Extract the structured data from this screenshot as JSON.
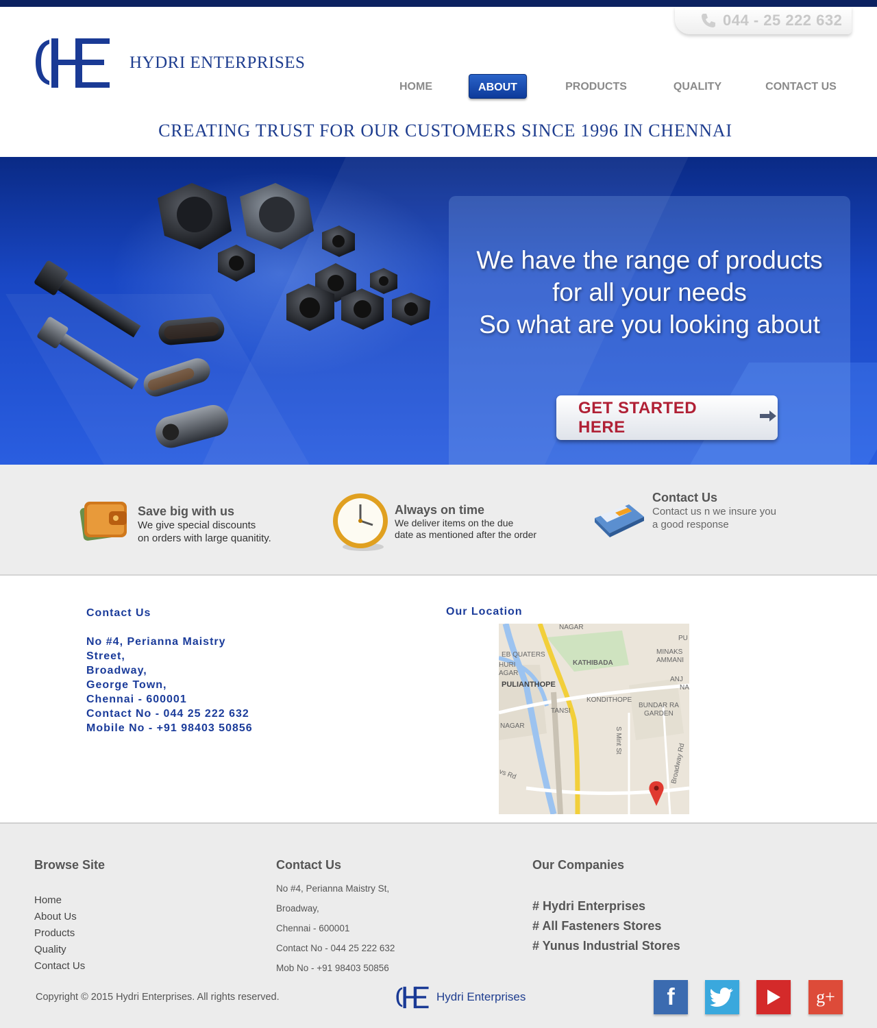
{
  "header": {
    "phone": "044 - 25 222 632",
    "company_name": "HYDRI ENTERPRISES",
    "tagline": "CREATING TRUST FOR OUR CUSTOMERS SINCE 1996 IN CHENNAI"
  },
  "nav": {
    "items": [
      {
        "label": "HOME",
        "active": false
      },
      {
        "label": "ABOUT",
        "active": true
      },
      {
        "label": "PRODUCTS",
        "active": false
      },
      {
        "label": "QUALITY",
        "active": false
      },
      {
        "label": "CONTACT US",
        "active": false
      }
    ]
  },
  "hero": {
    "line1": "We have the range of products",
    "line2": "for all your needs",
    "line3": "So what are you looking about",
    "button_label": "GET STARTED HERE"
  },
  "features": [
    {
      "icon": "wallet-icon",
      "title": "Save big with us",
      "desc1": "We give special discounts",
      "desc2": "on orders with large quanitity."
    },
    {
      "icon": "clock-icon",
      "title": "Always on time",
      "desc1": "We deliver items on the due",
      "desc2": "date as mentioned after the order"
    },
    {
      "icon": "calculator-phone-icon",
      "title": "Contact Us",
      "desc1": "Contact us n we insure you",
      "desc2": "a good response"
    }
  ],
  "contact": {
    "title": "Contact Us",
    "lines": [
      "No #4, Perianna Maistry",
      "Street,",
      "Broadway,",
      "George Town,",
      "Chennai - 600001",
      "Contact No - 044 25 222 632",
      "Mobile No - +91 98403 50856"
    ]
  },
  "location": {
    "title": "Our Location",
    "map_labels": [
      "NAGAR",
      "EB QUATERS",
      "KATHIBADA",
      "HURI",
      "AGAR",
      "PULIANTHOPE",
      "KONDITHOPE",
      "TANSI",
      "NAGAR",
      "BUNDAR RA",
      "GARDEN",
      "MINAKS",
      "AMMANI",
      "ANJ",
      "NA",
      "PU",
      "S Mint St",
      "Broadway Rd",
      "vs Rd"
    ]
  },
  "footer": {
    "browse_title": "Browse Site",
    "browse_links": [
      "Home",
      "About Us",
      "Products",
      "Quality",
      "Contact Us"
    ],
    "contact_title": "Contact Us",
    "contact_lines": [
      "No #4, Perianna Maistry St,",
      "Broadway,",
      "Chennai - 600001",
      "Contact No - 044 25 222 632",
      "Mob No - +91 98403 50856"
    ],
    "companies_title": "Our Companies",
    "companies": [
      "# Hydri Enterprises",
      "# All Fasteners Stores",
      "# Yunus Industrial Stores"
    ],
    "copyright": "Copyright © 2015 Hydri Enterprises. All rights reserved.",
    "logo_name": "Hydri Enterprises",
    "social": [
      {
        "icon": "facebook-icon",
        "glyph": "f",
        "color": "#3b6bb0"
      },
      {
        "icon": "twitter-icon",
        "glyph": "",
        "color": "#3aa8dd"
      },
      {
        "icon": "youtube-icon",
        "glyph": "",
        "color": "#d42a2a"
      },
      {
        "icon": "google-plus-icon",
        "glyph": "g+",
        "color": "#dd4b39"
      }
    ]
  }
}
